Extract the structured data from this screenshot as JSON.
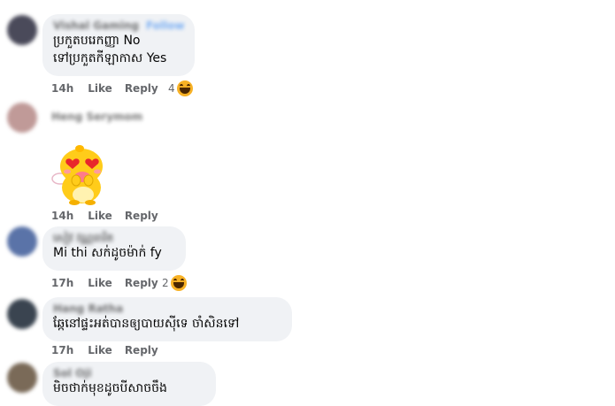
{
  "comments": [
    {
      "author": "Vishal Gaming",
      "follow": "Follow",
      "lines": [
        "ប្រកួតបរេកញ្ញា No",
        "ទៅប្រកួតកីឡាកាស Yes"
      ],
      "time": "14h",
      "like": "Like",
      "reply": "Reply",
      "reactions": "4",
      "reaction_icon": "haha-emoji-icon",
      "avatar_color": "#4a4a5a"
    },
    {
      "author": "Heng Serymom",
      "sticker": "heart-eyes-dragon-sticker",
      "time": "14h",
      "like": "Like",
      "reply": "Reply",
      "avatar_color": "#c09a98"
    },
    {
      "author": "សៀវ វណ្ណធារិត",
      "lines": [
        "Mi thi សក់ដូចម៉ាក់ fy"
      ],
      "time": "17h",
      "like": "Like",
      "reply": "Reply",
      "reactions": "2",
      "reaction_icon": "haha-emoji-icon",
      "avatar_color": "#5a73a8"
    },
    {
      "author": "Hang Ratha",
      "lines": [
        "ឆ្កែនៅផ្ទះអត់បានឲ្យបាយស៊ីទេ ចាំសិនទៅ"
      ],
      "time": "17h",
      "like": "Like",
      "reply": "Reply",
      "avatar_color": "#3a4450"
    },
    {
      "author": "Sol Oji",
      "lines": [
        "មិចថាក់មុខដូចបីសាចចឹង"
      ],
      "avatar_color": "#7a6a58"
    }
  ]
}
